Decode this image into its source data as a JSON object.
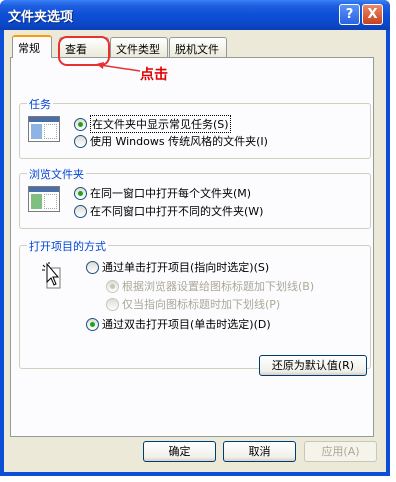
{
  "window": {
    "title": "文件夹选项",
    "help_glyph": "?",
    "close_glyph": "X"
  },
  "tabs": [
    {
      "label": "常规",
      "active": true
    },
    {
      "label": "查看",
      "active": false
    },
    {
      "label": "文件类型",
      "active": false
    },
    {
      "label": "脱机文件",
      "active": false
    }
  ],
  "annotation": {
    "text": "点击",
    "color": "#e40000"
  },
  "groups": {
    "tasks": {
      "title": "任务",
      "options": [
        {
          "label": "在文件夹中显示常见任务(S)",
          "checked": true
        },
        {
          "label": "使用 Windows 传统风格的文件夹(I)",
          "checked": false
        }
      ]
    },
    "browse": {
      "title": "浏览文件夹",
      "options": [
        {
          "label": "在同一窗口中打开每个文件夹(M)",
          "checked": true
        },
        {
          "label": "在不同窗口中打开不同的文件夹(W)",
          "checked": false
        }
      ]
    },
    "click": {
      "title": "打开项目的方式",
      "options": [
        {
          "label": "通过单击打开项目(指向时选定)(S)",
          "checked": false
        },
        {
          "label": "根据浏览器设置给图标标题加下划线(B)",
          "checked": true,
          "disabled": true
        },
        {
          "label": "仅当指向图标标题时加下划线(P)",
          "checked": false,
          "disabled": true
        },
        {
          "label": "通过双击打开项目(单击时选定)(D)",
          "checked": true
        }
      ]
    }
  },
  "buttons": {
    "restore_defaults": "还原为默认值(R)",
    "ok": "确定",
    "cancel": "取消",
    "apply": "应用(A)"
  },
  "colors": {
    "title_bar": "#0c4fd6",
    "group_title": "#0046d5",
    "dialog_bg": "#ece9d8"
  }
}
